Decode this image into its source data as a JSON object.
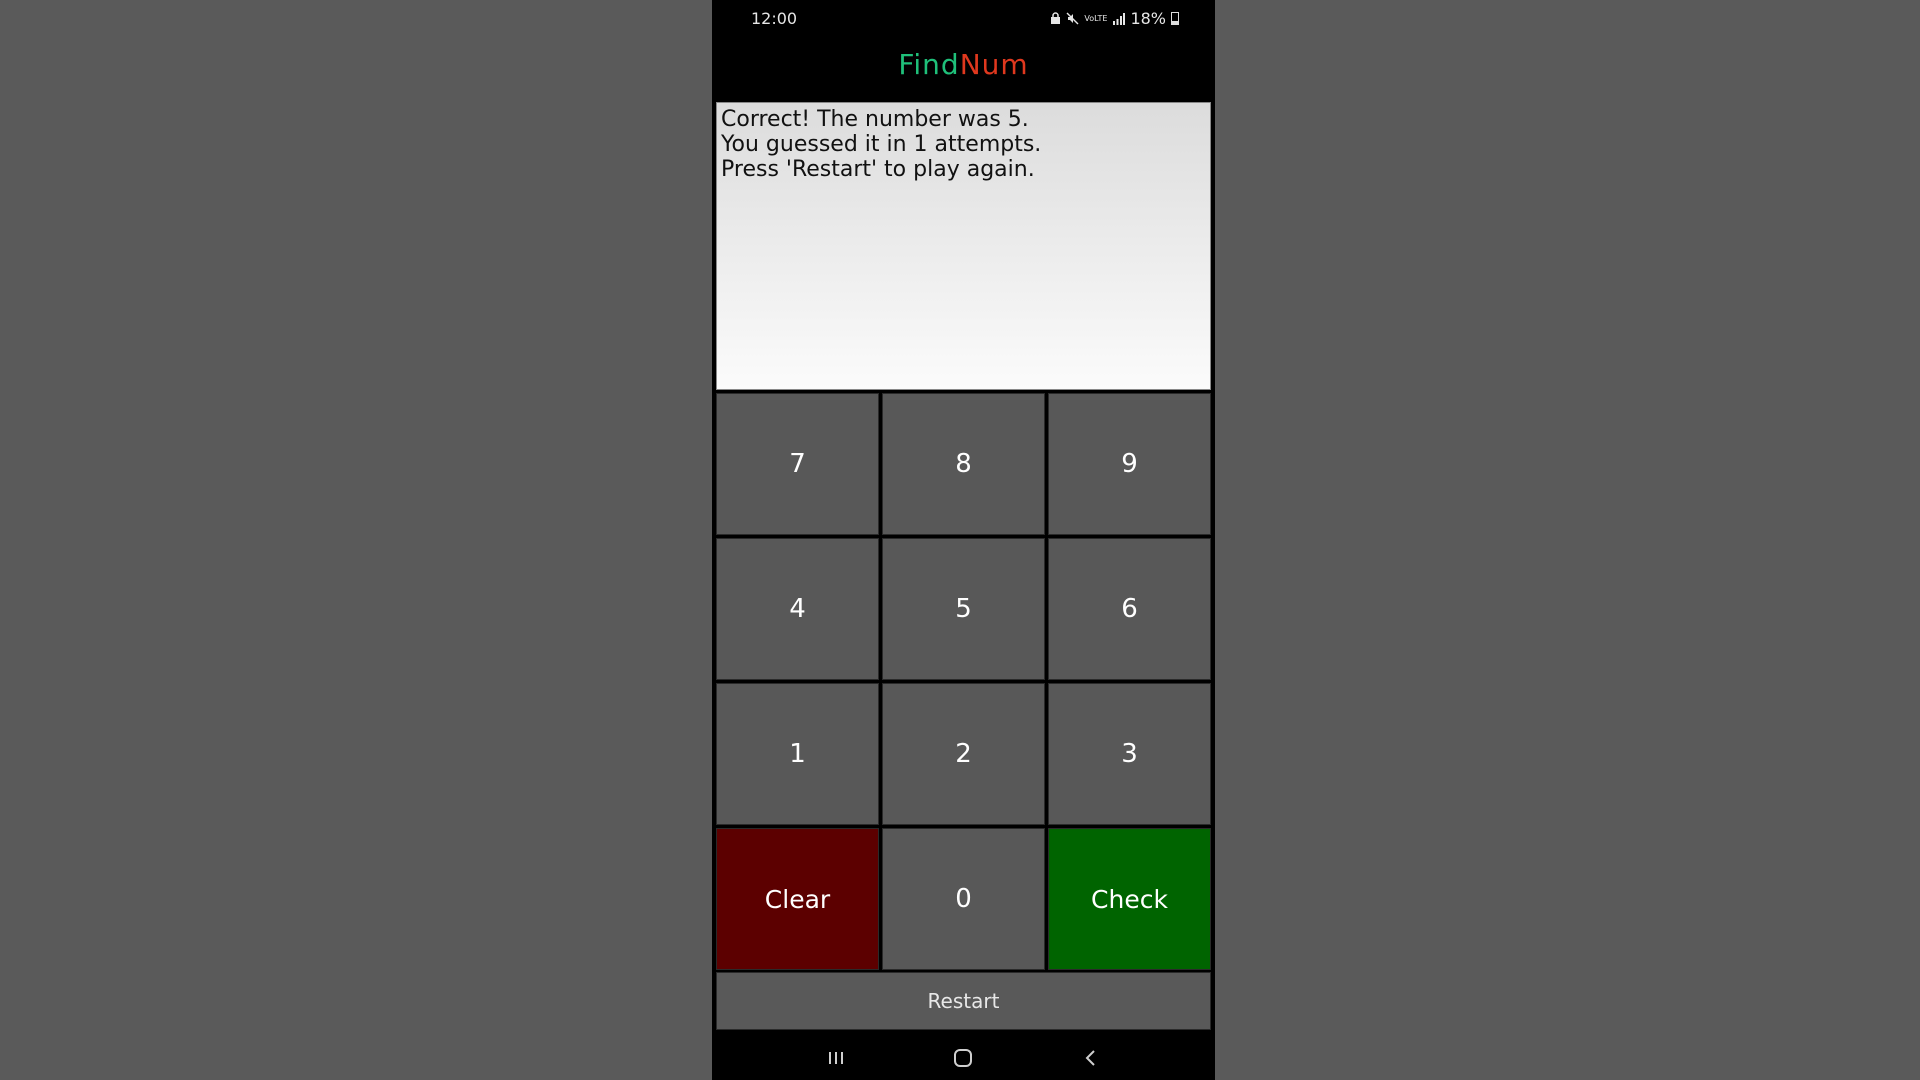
{
  "status_bar": {
    "time": "12:00",
    "network_label": "VoLTE",
    "battery_percent": "18%"
  },
  "app": {
    "title_part_1": "Find",
    "title_part_2": "Num",
    "title_color_1": "#1fc07a",
    "title_color_2": "#e0381e"
  },
  "message": {
    "text": "Correct! The number was 5.\nYou guessed it in 1 attempts.\nPress 'Restart' to play again."
  },
  "keypad": {
    "keys": [
      "7",
      "8",
      "9",
      "4",
      "5",
      "6",
      "1",
      "2",
      "3"
    ],
    "clear_label": "Clear",
    "zero_label": "0",
    "check_label": "Check",
    "clear_color": "#5c0000",
    "check_color": "#006400"
  },
  "restart_label": "Restart",
  "nav_bar": {
    "icons": [
      "recent-apps-icon",
      "home-icon",
      "back-icon"
    ]
  }
}
